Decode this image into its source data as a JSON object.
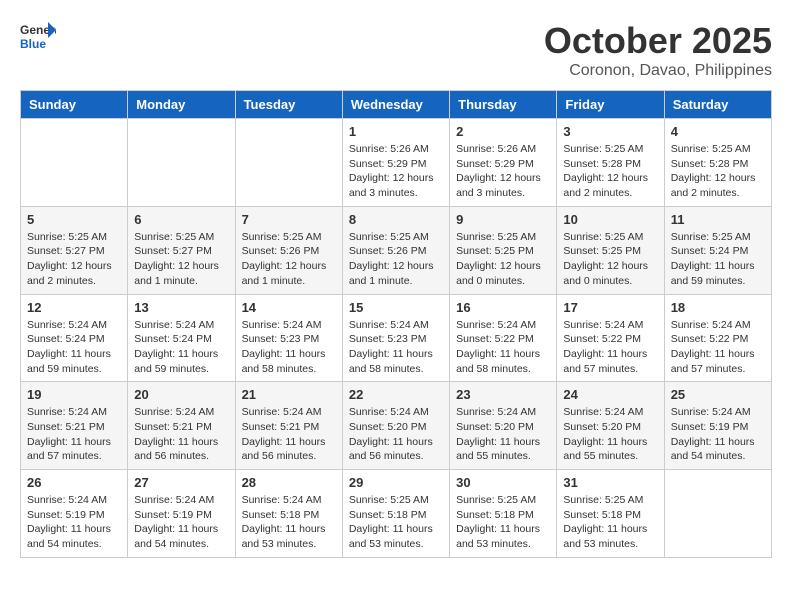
{
  "header": {
    "logo_general": "General",
    "logo_blue": "Blue",
    "month": "October 2025",
    "location": "Coronon, Davao, Philippines"
  },
  "weekdays": [
    "Sunday",
    "Monday",
    "Tuesday",
    "Wednesday",
    "Thursday",
    "Friday",
    "Saturday"
  ],
  "weeks": [
    [
      {
        "day": "",
        "info": ""
      },
      {
        "day": "",
        "info": ""
      },
      {
        "day": "",
        "info": ""
      },
      {
        "day": "1",
        "info": "Sunrise: 5:26 AM\nSunset: 5:29 PM\nDaylight: 12 hours and 3 minutes."
      },
      {
        "day": "2",
        "info": "Sunrise: 5:26 AM\nSunset: 5:29 PM\nDaylight: 12 hours and 3 minutes."
      },
      {
        "day": "3",
        "info": "Sunrise: 5:25 AM\nSunset: 5:28 PM\nDaylight: 12 hours and 2 minutes."
      },
      {
        "day": "4",
        "info": "Sunrise: 5:25 AM\nSunset: 5:28 PM\nDaylight: 12 hours and 2 minutes."
      }
    ],
    [
      {
        "day": "5",
        "info": "Sunrise: 5:25 AM\nSunset: 5:27 PM\nDaylight: 12 hours and 2 minutes."
      },
      {
        "day": "6",
        "info": "Sunrise: 5:25 AM\nSunset: 5:27 PM\nDaylight: 12 hours and 1 minute."
      },
      {
        "day": "7",
        "info": "Sunrise: 5:25 AM\nSunset: 5:26 PM\nDaylight: 12 hours and 1 minute."
      },
      {
        "day": "8",
        "info": "Sunrise: 5:25 AM\nSunset: 5:26 PM\nDaylight: 12 hours and 1 minute."
      },
      {
        "day": "9",
        "info": "Sunrise: 5:25 AM\nSunset: 5:25 PM\nDaylight: 12 hours and 0 minutes."
      },
      {
        "day": "10",
        "info": "Sunrise: 5:25 AM\nSunset: 5:25 PM\nDaylight: 12 hours and 0 minutes."
      },
      {
        "day": "11",
        "info": "Sunrise: 5:25 AM\nSunset: 5:24 PM\nDaylight: 11 hours and 59 minutes."
      }
    ],
    [
      {
        "day": "12",
        "info": "Sunrise: 5:24 AM\nSunset: 5:24 PM\nDaylight: 11 hours and 59 minutes."
      },
      {
        "day": "13",
        "info": "Sunrise: 5:24 AM\nSunset: 5:24 PM\nDaylight: 11 hours and 59 minutes."
      },
      {
        "day": "14",
        "info": "Sunrise: 5:24 AM\nSunset: 5:23 PM\nDaylight: 11 hours and 58 minutes."
      },
      {
        "day": "15",
        "info": "Sunrise: 5:24 AM\nSunset: 5:23 PM\nDaylight: 11 hours and 58 minutes."
      },
      {
        "day": "16",
        "info": "Sunrise: 5:24 AM\nSunset: 5:22 PM\nDaylight: 11 hours and 58 minutes."
      },
      {
        "day": "17",
        "info": "Sunrise: 5:24 AM\nSunset: 5:22 PM\nDaylight: 11 hours and 57 minutes."
      },
      {
        "day": "18",
        "info": "Sunrise: 5:24 AM\nSunset: 5:22 PM\nDaylight: 11 hours and 57 minutes."
      }
    ],
    [
      {
        "day": "19",
        "info": "Sunrise: 5:24 AM\nSunset: 5:21 PM\nDaylight: 11 hours and 57 minutes."
      },
      {
        "day": "20",
        "info": "Sunrise: 5:24 AM\nSunset: 5:21 PM\nDaylight: 11 hours and 56 minutes."
      },
      {
        "day": "21",
        "info": "Sunrise: 5:24 AM\nSunset: 5:21 PM\nDaylight: 11 hours and 56 minutes."
      },
      {
        "day": "22",
        "info": "Sunrise: 5:24 AM\nSunset: 5:20 PM\nDaylight: 11 hours and 56 minutes."
      },
      {
        "day": "23",
        "info": "Sunrise: 5:24 AM\nSunset: 5:20 PM\nDaylight: 11 hours and 55 minutes."
      },
      {
        "day": "24",
        "info": "Sunrise: 5:24 AM\nSunset: 5:20 PM\nDaylight: 11 hours and 55 minutes."
      },
      {
        "day": "25",
        "info": "Sunrise: 5:24 AM\nSunset: 5:19 PM\nDaylight: 11 hours and 54 minutes."
      }
    ],
    [
      {
        "day": "26",
        "info": "Sunrise: 5:24 AM\nSunset: 5:19 PM\nDaylight: 11 hours and 54 minutes."
      },
      {
        "day": "27",
        "info": "Sunrise: 5:24 AM\nSunset: 5:19 PM\nDaylight: 11 hours and 54 minutes."
      },
      {
        "day": "28",
        "info": "Sunrise: 5:24 AM\nSunset: 5:18 PM\nDaylight: 11 hours and 53 minutes."
      },
      {
        "day": "29",
        "info": "Sunrise: 5:25 AM\nSunset: 5:18 PM\nDaylight: 11 hours and 53 minutes."
      },
      {
        "day": "30",
        "info": "Sunrise: 5:25 AM\nSunset: 5:18 PM\nDaylight: 11 hours and 53 minutes."
      },
      {
        "day": "31",
        "info": "Sunrise: 5:25 AM\nSunset: 5:18 PM\nDaylight: 11 hours and 53 minutes."
      },
      {
        "day": "",
        "info": ""
      }
    ]
  ]
}
